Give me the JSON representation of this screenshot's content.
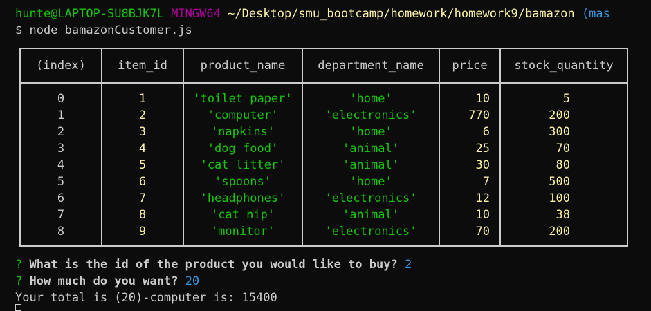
{
  "prompt": {
    "user_host": "hunte@LAPTOP-SU8BJK7L",
    "shell": "MINGW64",
    "path": "~/Desktop/smu_bootcamp/homework/homework9/bamazon",
    "branch_fragment": "(mas"
  },
  "command": "$ node bamazonCustomer.js",
  "table": {
    "headers": [
      "(index)",
      "item_id",
      "product_name",
      "department_name",
      "price",
      "stock_quantity"
    ],
    "rows": [
      [
        "0",
        "1",
        "'toilet paper'",
        "'home'",
        "10",
        "5"
      ],
      [
        "1",
        "2",
        "'computer'",
        "'electronics'",
        "770",
        "200"
      ],
      [
        "2",
        "3",
        "'napkins'",
        "'home'",
        "6",
        "300"
      ],
      [
        "3",
        "4",
        "'dog food'",
        "'animal'",
        "25",
        "70"
      ],
      [
        "4",
        "5",
        "'cat litter'",
        "'animal'",
        "30",
        "80"
      ],
      [
        "5",
        "6",
        "'spoons'",
        "'home'",
        "7",
        "500"
      ],
      [
        "6",
        "7",
        "'headphones'",
        "'electronics'",
        "12",
        "100"
      ],
      [
        "7",
        "8",
        "'cat nip'",
        "'animal'",
        "10",
        "38"
      ],
      [
        "8",
        "9",
        "'monitor'",
        "'electronics'",
        "70",
        "200"
      ]
    ]
  },
  "questions": [
    {
      "mark": "?",
      "text": "What is the id of the product you would like to buy?",
      "answer": "2"
    },
    {
      "mark": "?",
      "text": "How much do you want?",
      "answer": "20"
    }
  ],
  "result": "Your total is (20)-computer is: 15400"
}
